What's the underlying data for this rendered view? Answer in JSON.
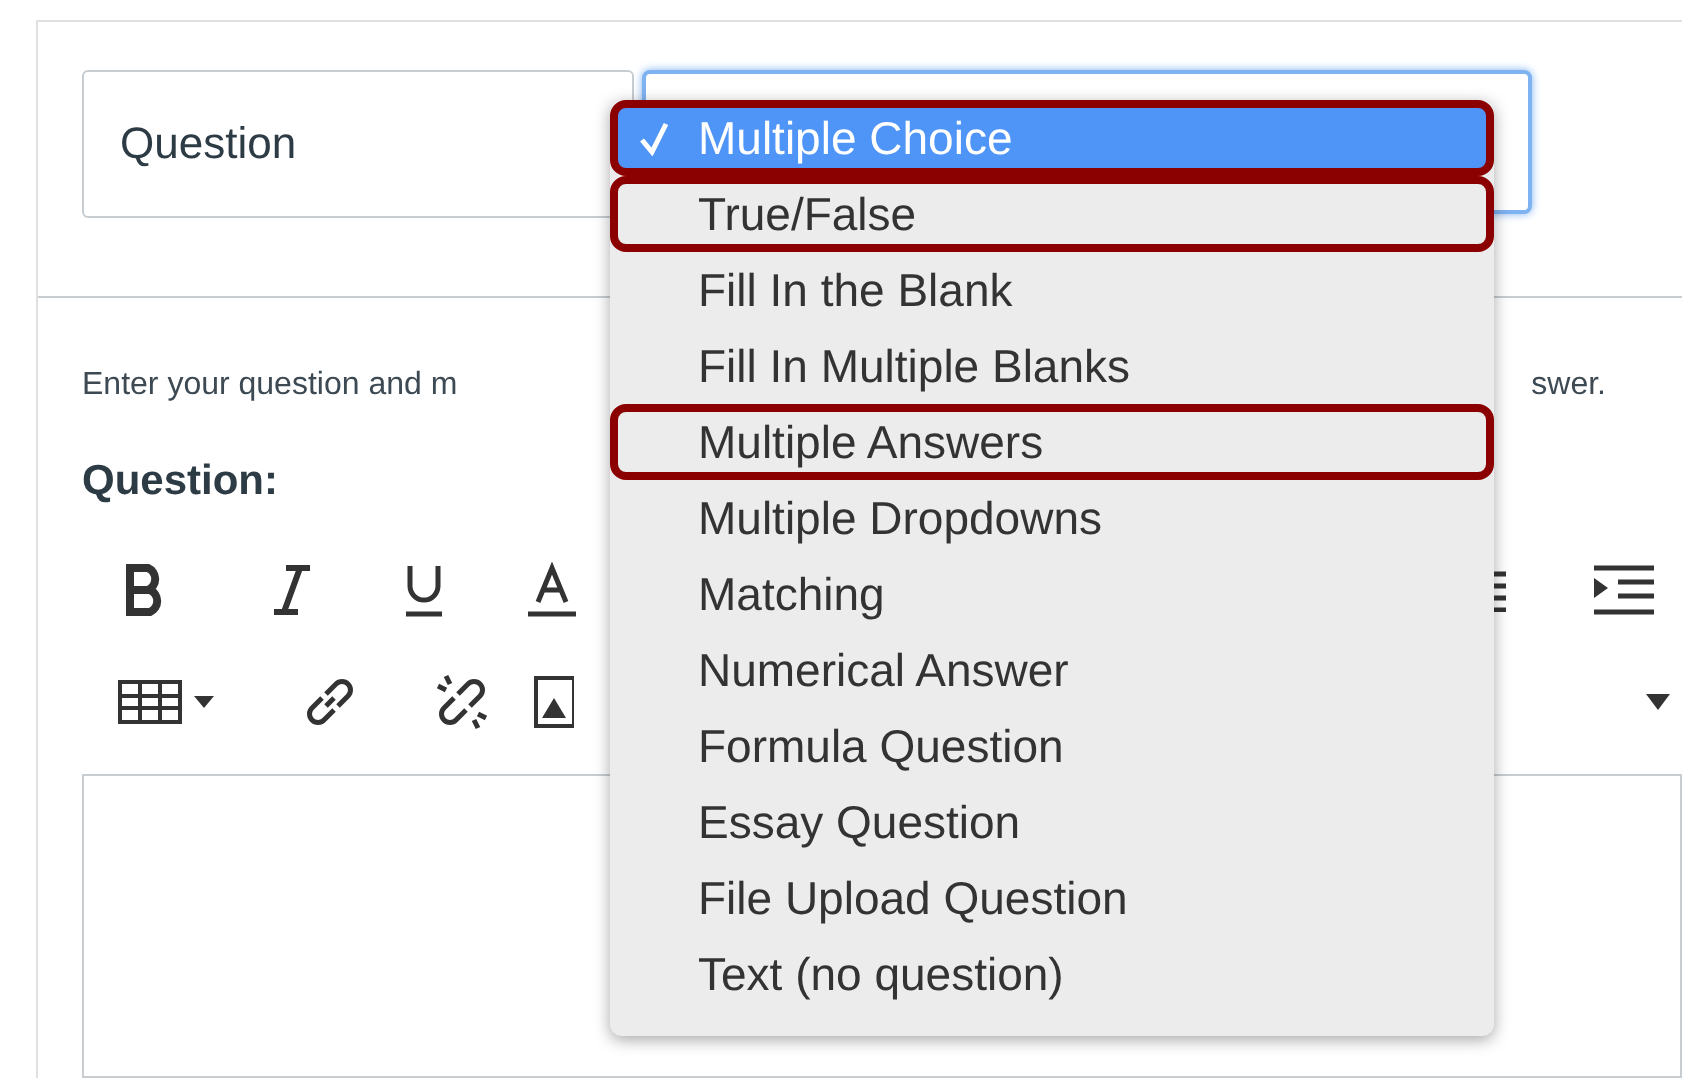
{
  "question_name": {
    "value": "Question"
  },
  "instructions": {
    "before_menu": "Enter your question and m",
    "after_menu": "swer."
  },
  "question_label": "Question:",
  "question_type_menu": {
    "items": [
      {
        "label": "Multiple Choice",
        "selected": true,
        "highlighted": true
      },
      {
        "label": "True/False",
        "selected": false,
        "highlighted": true
      },
      {
        "label": "Fill In the Blank",
        "selected": false,
        "highlighted": false
      },
      {
        "label": "Fill In Multiple Blanks",
        "selected": false,
        "highlighted": false
      },
      {
        "label": "Multiple Answers",
        "selected": false,
        "highlighted": true
      },
      {
        "label": "Multiple Dropdowns",
        "selected": false,
        "highlighted": false
      },
      {
        "label": "Matching",
        "selected": false,
        "highlighted": false
      },
      {
        "label": "Numerical Answer",
        "selected": false,
        "highlighted": false
      },
      {
        "label": "Formula Question",
        "selected": false,
        "highlighted": false
      },
      {
        "label": "Essay Question",
        "selected": false,
        "highlighted": false
      },
      {
        "label": "File Upload Question",
        "selected": false,
        "highlighted": false
      },
      {
        "label": "Text (no question)",
        "selected": false,
        "highlighted": false
      }
    ]
  }
}
